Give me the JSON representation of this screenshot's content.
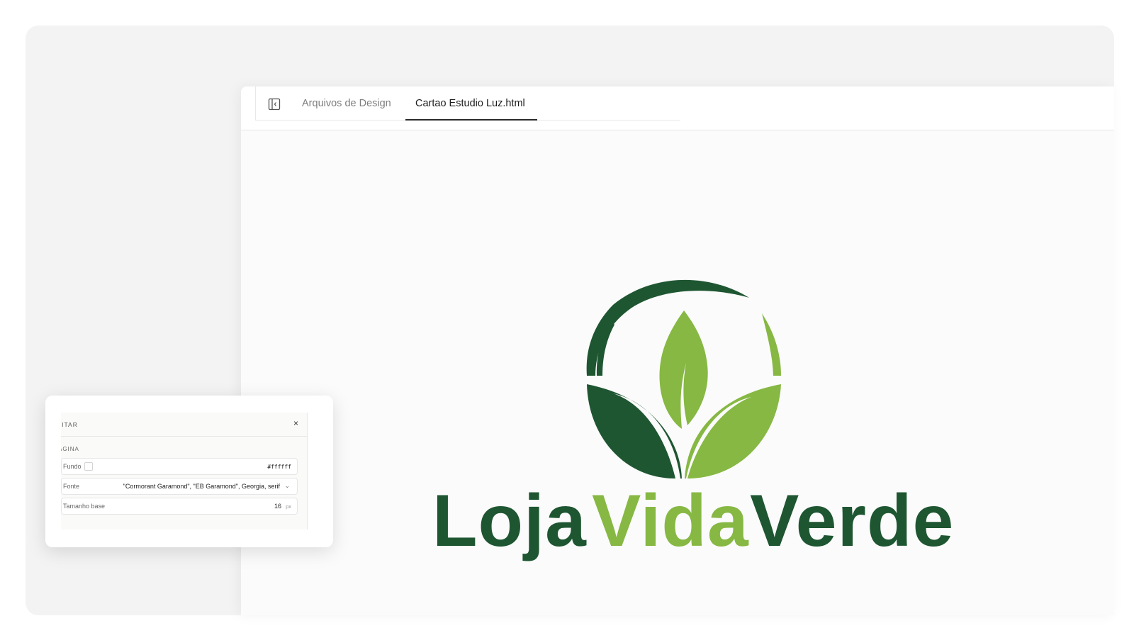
{
  "tabs": {
    "design_files": "Arquivos de Design",
    "active_file": "Cartao Estudio Luz.html"
  },
  "logo": {
    "word1": "Loja",
    "word2": "Vida",
    "word3": "Verde",
    "colors": {
      "dark_green": "#1e5631",
      "light_green": "#86b843"
    }
  },
  "edit_panel": {
    "title": "DITAR",
    "section": "ÁGINA",
    "background_label": "Fundo",
    "background_value": "#ffffff",
    "font_label": "Fonte",
    "font_value": "\"Cormorant Garamond\", \"EB Garamond\", Georgia, serif",
    "base_size_label": "Tamanho base",
    "base_size_value": "16",
    "base_size_unit": "px"
  }
}
